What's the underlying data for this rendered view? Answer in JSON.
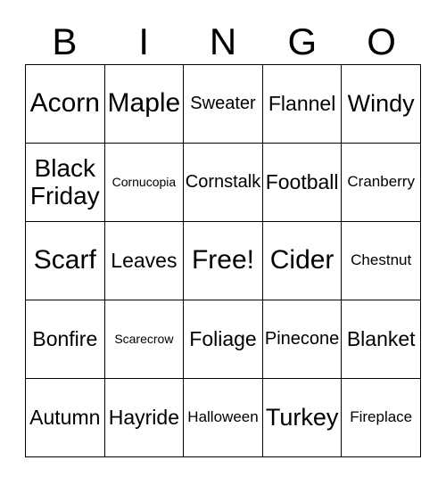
{
  "card": {
    "title_letters": [
      "B",
      "I",
      "N",
      "G",
      "O"
    ],
    "colors": {
      "background": "#ffffff",
      "text": "#000000",
      "grid_line": "#000000"
    },
    "grid_size": "5x5",
    "free_space": "Free!",
    "rows": [
      [
        {
          "label": "Acorn",
          "size": "t-xl"
        },
        {
          "label": "Maple",
          "size": "t-xl"
        },
        {
          "label": "Sweater",
          "size": "t-sm"
        },
        {
          "label": "Flannel",
          "size": "t-md"
        },
        {
          "label": "Windy",
          "size": "t-lg"
        }
      ],
      [
        {
          "label": "Black\nFriday",
          "size": "t-two"
        },
        {
          "label": "Cornucopia",
          "size": "t-xxs"
        },
        {
          "label": "Cornstalk",
          "size": "t-sm"
        },
        {
          "label": "Football",
          "size": "t-md"
        },
        {
          "label": "Cranberry",
          "size": "t-xs"
        }
      ],
      [
        {
          "label": "Scarf",
          "size": "t-xl"
        },
        {
          "label": "Leaves",
          "size": "t-md"
        },
        {
          "label": "Free!",
          "size": "t-xl"
        },
        {
          "label": "Cider",
          "size": "t-xl"
        },
        {
          "label": "Chestnut",
          "size": "t-xs"
        }
      ],
      [
        {
          "label": "Bonfire",
          "size": "t-md"
        },
        {
          "label": "Scarecrow",
          "size": "t-xxs"
        },
        {
          "label": "Foliage",
          "size": "t-md"
        },
        {
          "label": "Pinecone",
          "size": "t-sm"
        },
        {
          "label": "Blanket",
          "size": "t-md"
        }
      ],
      [
        {
          "label": "Autumn",
          "size": "t-md"
        },
        {
          "label": "Hayride",
          "size": "t-md"
        },
        {
          "label": "Halloween",
          "size": "t-xs"
        },
        {
          "label": "Turkey",
          "size": "t-lg"
        },
        {
          "label": "Fireplace",
          "size": "t-xs"
        }
      ]
    ]
  }
}
